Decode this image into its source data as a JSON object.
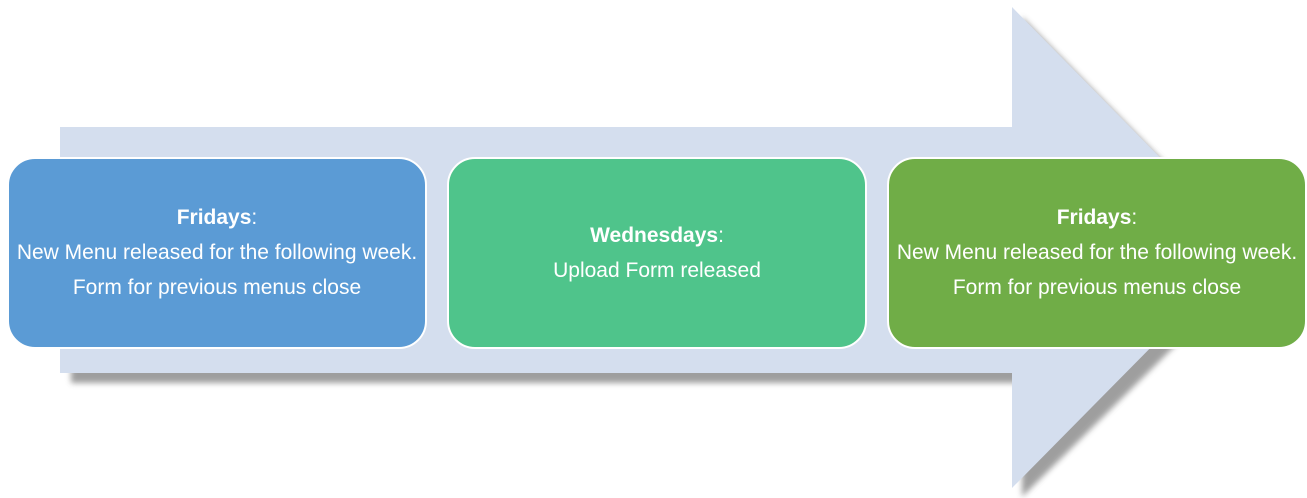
{
  "colors": {
    "arrow_fill": "#d4deee",
    "arrow_shadow": "#8e8e8e",
    "card_1": "#5b9bd5",
    "card_2": "#4fc48b",
    "card_3": "#70ad47",
    "text": "#ffffff"
  },
  "steps": [
    {
      "title": "Fridays",
      "colon": ":",
      "lines": [
        "New Menu released for the following week.",
        "Form for previous menus close"
      ]
    },
    {
      "title": "Wednesdays",
      "colon": ":",
      "lines": [
        "Upload Form released"
      ]
    },
    {
      "title": "Fridays",
      "colon": ":",
      "lines": [
        "New Menu released for the following week.",
        "Form for previous menus close"
      ]
    }
  ]
}
